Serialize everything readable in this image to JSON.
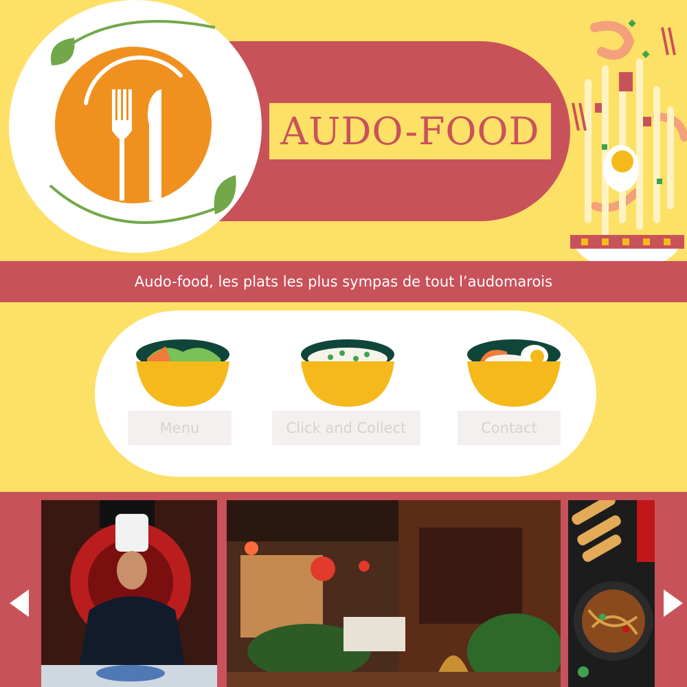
{
  "brand": {
    "name": "AUDO-FOOD"
  },
  "tagline": "Audo-food, les plats les plus sympas de tout l’audomarois",
  "nav": [
    {
      "label": "Menu",
      "bowl": "salad-bowl-icon"
    },
    {
      "label": "Click and Collect",
      "bowl": "rice-bowl-icon"
    },
    {
      "label": "Contact",
      "bowl": "ramen-bowl-icon"
    }
  ],
  "gallery": {
    "photos": [
      "chef-photo",
      "restaurant-interior-photo",
      "dishes-photo"
    ],
    "controls": [
      "previous-arrow",
      "next-arrow"
    ]
  },
  "colors": {
    "background": "#fde066",
    "brand_red": "#c8525a",
    "logo_orange": "#f0911f",
    "leaf_green": "#72a84a",
    "button_bg": "#f3f0ef",
    "button_text": "#d6d2d0"
  }
}
